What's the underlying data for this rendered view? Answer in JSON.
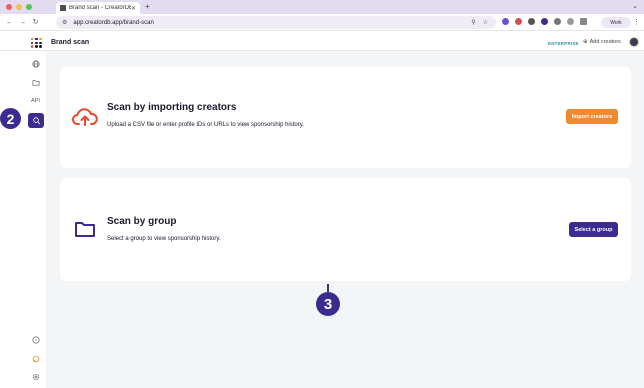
{
  "browser": {
    "tab_title": "Brand scan - CreatorDB",
    "new_tab": "+",
    "url": "app.creatordb.app/brand-scan",
    "profile_label": "Work"
  },
  "header": {
    "page_title": "Brand scan",
    "plan_badge": "ENTERPRISE",
    "add_creators_label": "Add creators"
  },
  "sidebar": {
    "api_label": "API",
    "items": [
      "globe-icon",
      "folder-icon",
      "api",
      "brand-scan-icon",
      "help-icon",
      "alert-icon",
      "settings-icon"
    ]
  },
  "cards": [
    {
      "title": "Scan by importing creators",
      "description": "Upload a CSV file or enter profile IDs or URLs to view sponsorship history.",
      "button_label": "Import creators",
      "icon": "cloud-upload-icon"
    },
    {
      "title": "Scan by group",
      "description": "Select a group to view sponsorship history.",
      "button_label": "Select a group",
      "icon": "folder-icon"
    }
  ],
  "callouts": [
    "2",
    "3"
  ],
  "colors": {
    "accent_purple": "#3b2d8f",
    "accent_orange": "#f08a2e",
    "badge_teal": "#2d8f9e"
  }
}
